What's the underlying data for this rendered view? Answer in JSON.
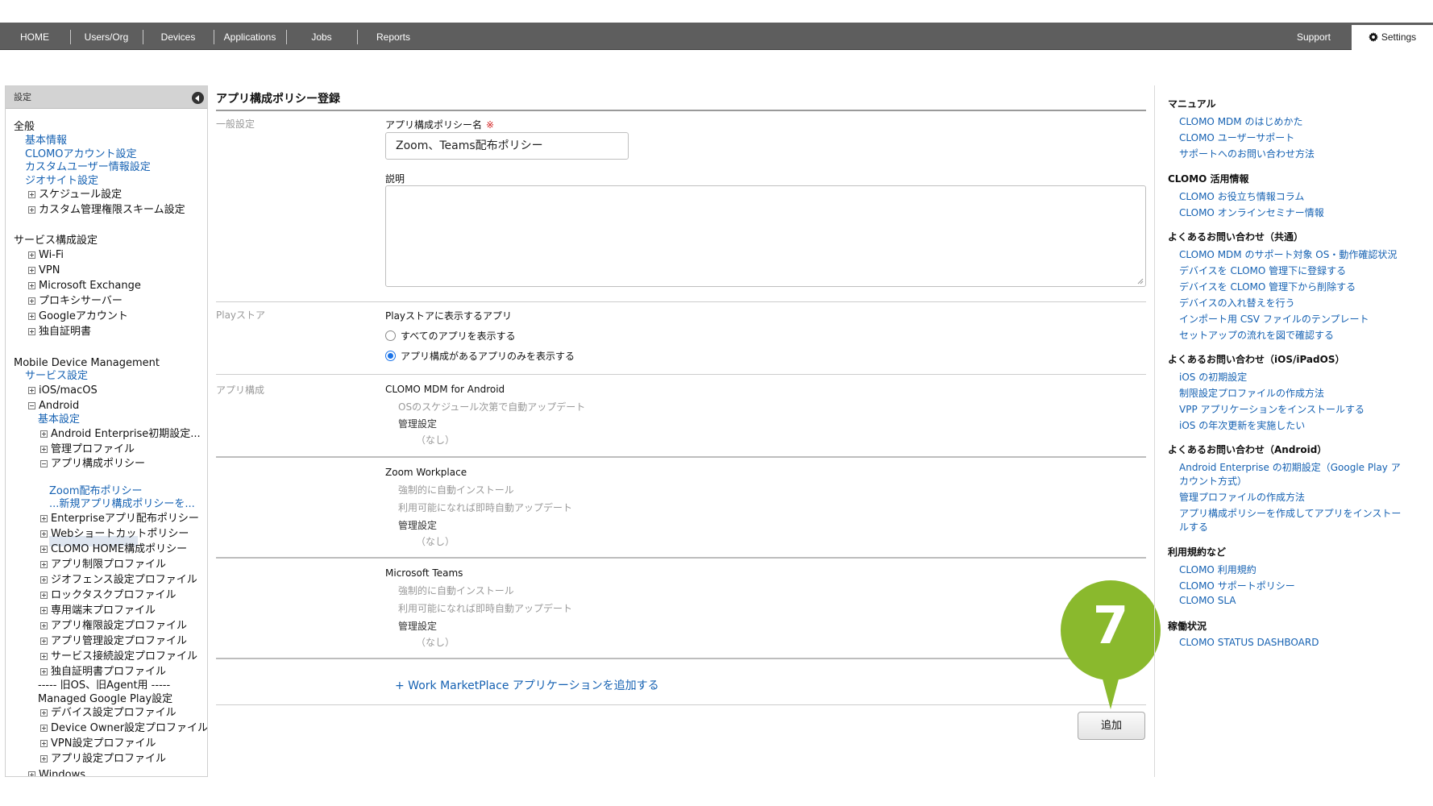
{
  "nav": {
    "items": [
      "HOME",
      "Users/Org",
      "Devices",
      "Applications",
      "Jobs",
      "Reports"
    ],
    "support": "Support",
    "settings": "Settings"
  },
  "sidebar": {
    "header": "設定",
    "sections": {
      "general": "全般",
      "general_items": [
        "基本情報",
        "CLOMOアカウント設定",
        "カスタムユーザー情報設定",
        "ジオサイト設定"
      ],
      "general_tree": [
        "スケジュール設定",
        "カスタム管理権限スキーム設定"
      ],
      "service": "サービス構成設定",
      "service_tree": [
        "Wi-Fi",
        "VPN",
        "Microsoft Exchange",
        "プロキシサーバー",
        "Googleアカウント",
        "独自証明書"
      ],
      "mdm": "Mobile Device Management",
      "mdm_link": "サービス設定",
      "ios": "iOS/macOS",
      "android": "Android",
      "android_basic": "基本設定",
      "android_ent": "Android Enterprise初期設定...",
      "mgmt_profile": "管理プロファイル",
      "app_config_policy": "アプリ構成ポリシー",
      "zoom_policy": "Zoom配布ポリシー",
      "new_policy": "...新規アプリ構成ポリシーを...",
      "android_tree2": [
        "Enterpriseアプリ配布ポリシー",
        "Webショートカットポリシー",
        "CLOMO HOME構成ポリシー",
        "アプリ制限プロファイル",
        "ジオフェンス設定プロファイル",
        "ロックタスクプロファイル",
        "専用端末プロファイル",
        "アプリ権限設定プロファイル",
        "アプリ管理設定プロファイル",
        "サービス接続設定プロファイル",
        "独自証明書プロファイル"
      ],
      "legacy": "----- 旧OS、旧Agent用 -----",
      "mgp": "Managed Google Play設定",
      "legacy_tree": [
        "デバイス設定プロファイル",
        "Device Owner設定プロファイル",
        "VPN設定プロファイル",
        "アプリ設定プロファイル"
      ],
      "windows": "Windows"
    }
  },
  "main": {
    "title": "アプリ構成ポリシー登録",
    "general_label": "一般設定",
    "name_label": "アプリ構成ポリシー名",
    "required_mark": "※",
    "name_value": "Zoom、Teams配布ポリシー",
    "desc_label": "説明",
    "play_label": "Playストア",
    "play_field": "Playストアに表示するアプリ",
    "radio_all": "すべてのアプリを表示する",
    "radio_config": "アプリ構成があるアプリのみを表示する",
    "app_config_label": "アプリ構成",
    "apps": [
      {
        "name": "CLOMO MDM for Android",
        "line1": "OSのスケジュール次第で自動アップデート",
        "mgmt": "管理設定",
        "none": "（なし）"
      },
      {
        "name": "Zoom Workplace",
        "line1": "強制的に自動インストール",
        "line2": "利用可能になれば即時自動アップデート",
        "mgmt": "管理設定",
        "none": "（なし）"
      },
      {
        "name": "Microsoft Teams",
        "line1": "強制的に自動インストール",
        "line2": "利用可能になれば即時自動アップデート",
        "mgmt": "管理設定",
        "none": "（なし）"
      }
    ],
    "add_marketplace": "+ Work MarketPlace アプリケーションを追加する",
    "add_button": "追加"
  },
  "callout": {
    "number": "7",
    "color": "#8ab92d"
  },
  "right": {
    "groups": [
      {
        "title": "マニュアル",
        "links": [
          "CLOMO MDM のはじめかた",
          "CLOMO ユーザーサポート",
          "サポートへのお問い合わせ方法"
        ]
      },
      {
        "title": "CLOMO 活用情報",
        "links": [
          "CLOMO お役立ち情報コラム",
          "CLOMO オンラインセミナー情報"
        ]
      },
      {
        "title": "よくあるお問い合わせ（共通）",
        "links": [
          "CLOMO MDM のサポート対象 OS・動作確認状況",
          "デバイスを CLOMO 管理下に登録する",
          "デバイスを CLOMO 管理下から削除する",
          "デバイスの入れ替えを行う",
          "インポート用 CSV ファイルのテンプレート",
          "セットアップの流れを図で確認する"
        ]
      },
      {
        "title": "よくあるお問い合わせ（iOS/iPadOS）",
        "links": [
          "iOS の初期設定",
          "制限設定プロファイルの作成方法",
          "VPP アプリケーションをインストールする",
          "iOS の年次更新を実施したい"
        ]
      },
      {
        "title": "よくあるお問い合わせ（Android）",
        "links": [
          "Android Enterprise の初期設定（Google Play ア",
          "カウント方式）",
          "管理プロファイルの作成方法",
          "アプリ構成ポリシーを作成してアプリをインストー",
          "ルする"
        ]
      },
      {
        "title": "利用規約など",
        "links": [
          "CLOMO 利用規約",
          "CLOMO サポートポリシー",
          "CLOMO SLA"
        ]
      },
      {
        "title": "稼働状況",
        "links": [
          "CLOMO STATUS DASHBOARD"
        ]
      }
    ]
  }
}
